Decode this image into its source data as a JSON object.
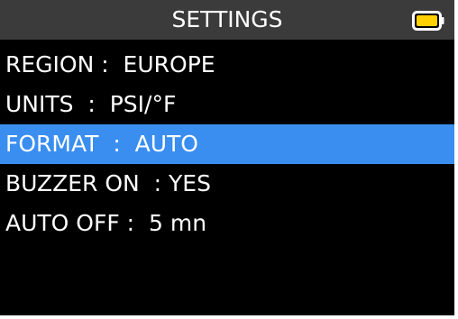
{
  "header": {
    "title": "SETTINGS",
    "battery_icon": "battery-icon"
  },
  "menu": {
    "items": [
      {
        "label": "REGION :  EUROPE",
        "selected": false
      },
      {
        "label": "UNITS  :  PSI/°F",
        "selected": false
      },
      {
        "label": "FORMAT  :  AUTO",
        "selected": true
      },
      {
        "label": "BUZZER ON  : YES",
        "selected": false
      },
      {
        "label": "AUTO OFF :  5 mn",
        "selected": false
      }
    ]
  },
  "colors": {
    "background": "#000000",
    "header": "#3b3b3b",
    "highlight": "#3a8ef0",
    "text": "#ffffff",
    "battery_fill": "#ffd000"
  }
}
